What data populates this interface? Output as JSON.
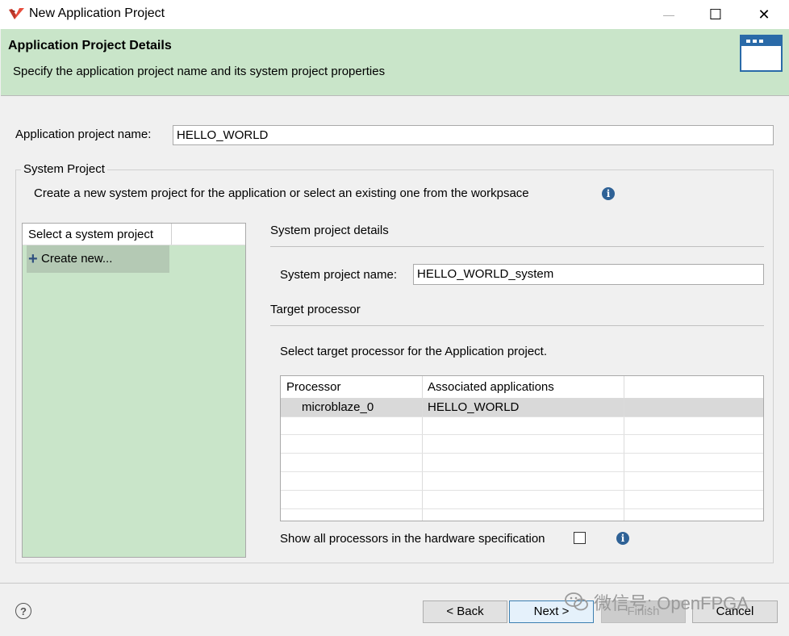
{
  "window": {
    "title": "New Application Project",
    "minimize_glyph": "—",
    "maximize_glyph": "☐",
    "close_glyph": "✕"
  },
  "header": {
    "title": "Application Project Details",
    "subtitle": "Specify the application project name and its system project properties"
  },
  "app_project": {
    "label": "Application project name:",
    "value": "HELLO_WORLD"
  },
  "system_project": {
    "group_label": "System Project",
    "description": "Create a new system project for the application or select an existing one from the workpsace",
    "list": {
      "header": "Select a system project",
      "items": [
        {
          "label": "Create new...",
          "icon": "plus-icon",
          "selected": true
        }
      ]
    },
    "details": {
      "heading": "System project details",
      "name_label": "System project name:",
      "name_value": "HELLO_WORLD_system"
    },
    "target": {
      "heading": "Target processor",
      "instruction": "Select target processor for the Application project.",
      "columns": [
        "Processor",
        "Associated applications"
      ],
      "rows": [
        {
          "processor": "microblaze_0",
          "applications": "HELLO_WORLD"
        }
      ],
      "show_all_label": "Show all processors in the hardware specification",
      "show_all_checked": false
    }
  },
  "footer": {
    "help_glyph": "?",
    "back_label": "< Back",
    "next_label": "Next >",
    "finish_label": "Finish",
    "cancel_label": "Cancel",
    "finish_enabled": false
  },
  "watermark": "微信号: OpenFPGA",
  "colors": {
    "header_bg": "#c9e5c9",
    "list_bg": "#c9e5c9",
    "selection_bg": "#b4c9b4",
    "info_blue": "#2f6296"
  }
}
